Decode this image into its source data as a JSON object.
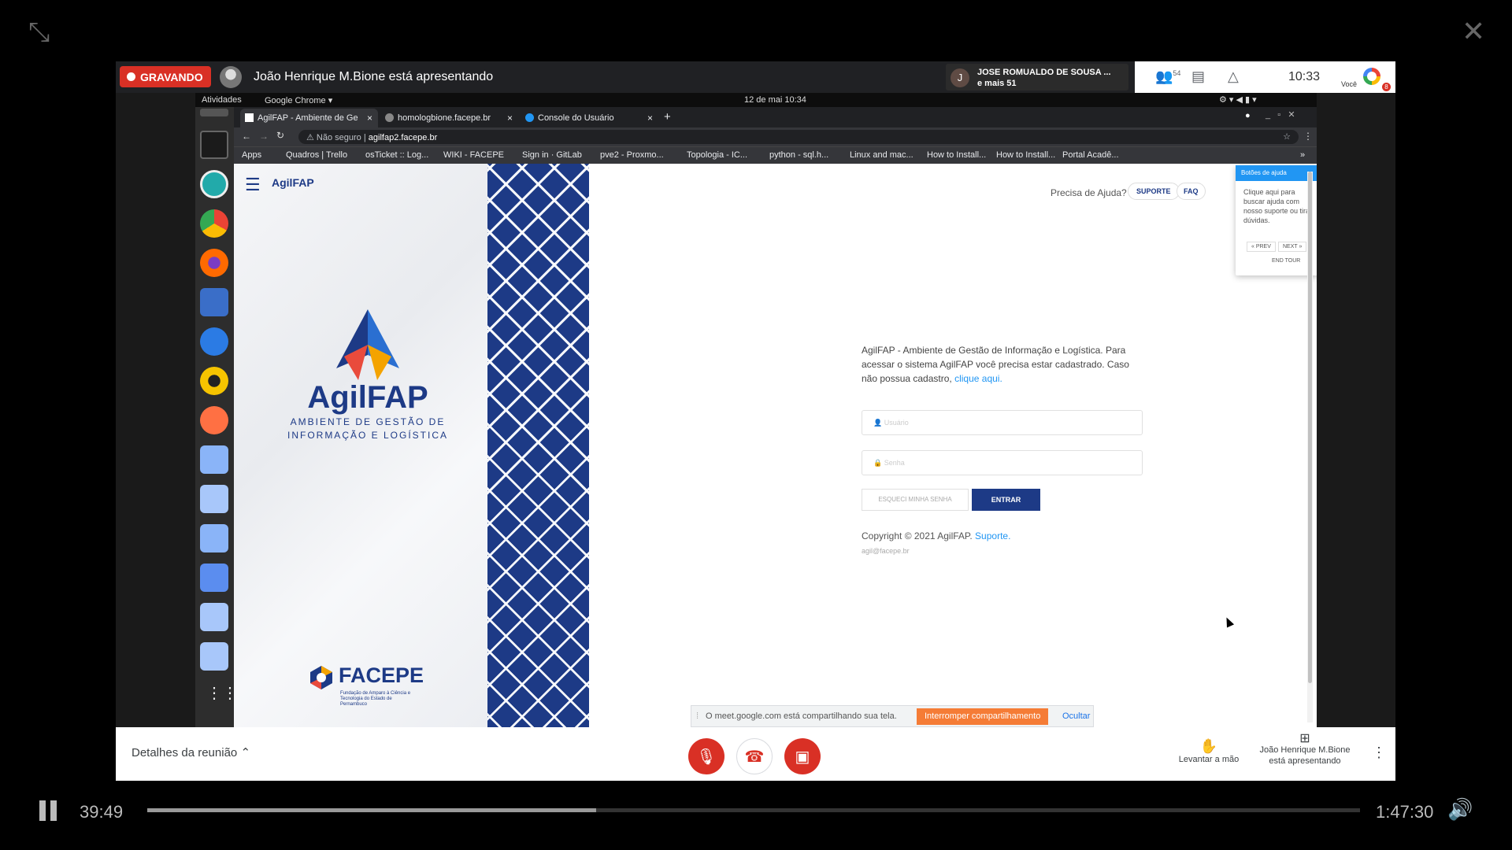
{
  "meet": {
    "recording_label": "GRAVANDO",
    "presenter_text": "João Henrique M.Bione está apresentando",
    "participant_initial": "J",
    "participant_name": "JOSE ROMUALDO DE SOUSA ...",
    "participant_more": "e mais 51",
    "people_count": "54",
    "time": "10:33",
    "you_label": "Você",
    "badge": "8",
    "details_label": "Detalhes da reunião",
    "raise_hand": "Levantar a mão",
    "presenting_line1": "João Henrique M.Bione",
    "presenting_line2": "está apresentando"
  },
  "desktop": {
    "activities": "Atividades",
    "app_menu": "Google Chrome ▾",
    "datetime": "12 de mai  10:34"
  },
  "browser": {
    "tabs": [
      {
        "label": "AgilFAP - Ambiente de Ge",
        "active": true
      },
      {
        "label": "homologbione.facepe.br",
        "active": false
      },
      {
        "label": "Console do Usuário",
        "active": false
      }
    ],
    "new_tab": "+",
    "security": "Não seguro",
    "url": "agilfap2.facepe.br",
    "bookmarks": [
      "Apps",
      "Quadros | Trello",
      "osTicket :: Log...",
      "WIKI - FACEPE",
      "Sign in · GitLab",
      "pve2 - Proxmo...",
      "Topologia - IC...",
      "python - sql.h...",
      "Linux and mac...",
      "How to Install...",
      "How to Install...",
      "Portal Acadê..."
    ],
    "more_bookmarks": "»"
  },
  "page": {
    "app_name": "AgilFAP",
    "logo_title": "AgilFAP",
    "logo_sub1": "AMBIENTE DE GESTÃO DE",
    "logo_sub2": "INFORMAÇÃO E LOGÍSTICA",
    "help_question": "Precisa de Ajuda?",
    "btn_support": "SUPORTE",
    "btn_faq": "FAQ",
    "tour_title": "Botões de ajuda",
    "tour_text": "Clique aqui para buscar ajuda com nosso suporte ou tirar dúvidas.",
    "tour_prev": "« PREV",
    "tour_next": "NEXT »",
    "tour_end": "END TOUR",
    "intro_text": "AgilFAP - Ambiente de Gestão de Informação e Logística. Para acessar o sistema AgilFAP você precisa estar cadastrado. Caso não possua cadastro, ",
    "intro_link": "clique aqui.",
    "user_placeholder": "Usuário",
    "pass_placeholder": "Senha",
    "btn_forgot": "ESQUECI MINHA SENHA",
    "btn_enter": "ENTRAR",
    "copyright": "Copyright © 2021 AgilFAP. ",
    "copyright_link": "Suporte.",
    "email": "agil@facepe.br",
    "facepe": "FACEPE",
    "facepe_sub": "Fundação de Amparo à Ciência e Tecnologia do Estado de Pernambuco"
  },
  "share_bar": {
    "message": "O meet.google.com está compartilhando sua tela.",
    "stop": "Interromper compartilhamento",
    "hide": "Ocultar"
  },
  "player": {
    "current_time": "39:49",
    "total_time": "1:47:30",
    "progress": 0.3704,
    "buffered": 0.3
  },
  "colors": {
    "recording": "#d93025",
    "brand": "#1d3a86",
    "share_stop": "#f57c36"
  }
}
